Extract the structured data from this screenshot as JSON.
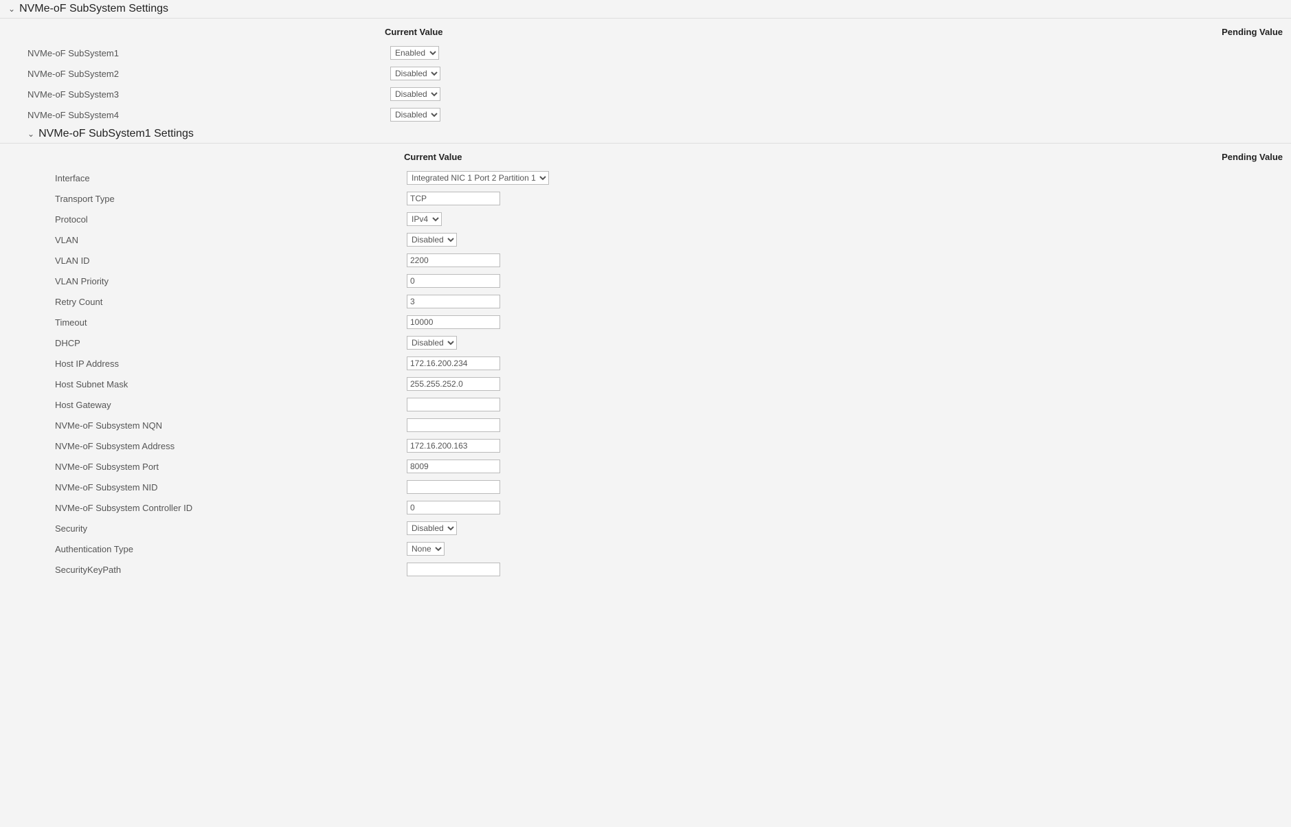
{
  "root": {
    "title": "NVMe-oF SubSystem Settings",
    "colCurrent": "Current Value",
    "colPending": "Pending Value",
    "subsystems": [
      {
        "label": "NVMe-oF SubSystem1",
        "value": "Enabled"
      },
      {
        "label": "NVMe-oF SubSystem2",
        "value": "Disabled"
      },
      {
        "label": "NVMe-oF SubSystem3",
        "value": "Disabled"
      },
      {
        "label": "NVMe-oF SubSystem4",
        "value": "Disabled"
      }
    ]
  },
  "sub1": {
    "title": "NVMe-oF SubSystem1 Settings",
    "colCurrent": "Current Value",
    "colPending": "Pending Value",
    "rows": [
      {
        "label": "Interface",
        "type": "select",
        "value": "Integrated NIC 1 Port 2 Partition 1"
      },
      {
        "label": "Transport Type",
        "type": "text",
        "value": "TCP"
      },
      {
        "label": "Protocol",
        "type": "select",
        "value": "IPv4"
      },
      {
        "label": "VLAN",
        "type": "select",
        "value": "Disabled"
      },
      {
        "label": "VLAN ID",
        "type": "text",
        "value": "2200"
      },
      {
        "label": "VLAN Priority",
        "type": "text",
        "value": "0"
      },
      {
        "label": "Retry Count",
        "type": "text",
        "value": "3"
      },
      {
        "label": "Timeout",
        "type": "text",
        "value": "10000"
      },
      {
        "label": "DHCP",
        "type": "select",
        "value": "Disabled"
      },
      {
        "label": "Host IP Address",
        "type": "text",
        "value": "172.16.200.234"
      },
      {
        "label": "Host Subnet Mask",
        "type": "text",
        "value": "255.255.252.0"
      },
      {
        "label": "Host Gateway",
        "type": "text",
        "value": ""
      },
      {
        "label": "NVMe-oF Subsystem NQN",
        "type": "text",
        "value": ""
      },
      {
        "label": "NVMe-oF Subsystem Address",
        "type": "text",
        "value": "172.16.200.163"
      },
      {
        "label": "NVMe-oF Subsystem Port",
        "type": "text",
        "value": "8009"
      },
      {
        "label": "NVMe-oF Subsystem NID",
        "type": "text",
        "value": ""
      },
      {
        "label": "NVMe-oF Subsystem Controller ID",
        "type": "text",
        "value": "0"
      },
      {
        "label": "Security",
        "type": "select",
        "value": "Disabled"
      },
      {
        "label": "Authentication Type",
        "type": "select",
        "value": "None"
      },
      {
        "label": "SecurityKeyPath",
        "type": "text",
        "value": ""
      }
    ]
  }
}
